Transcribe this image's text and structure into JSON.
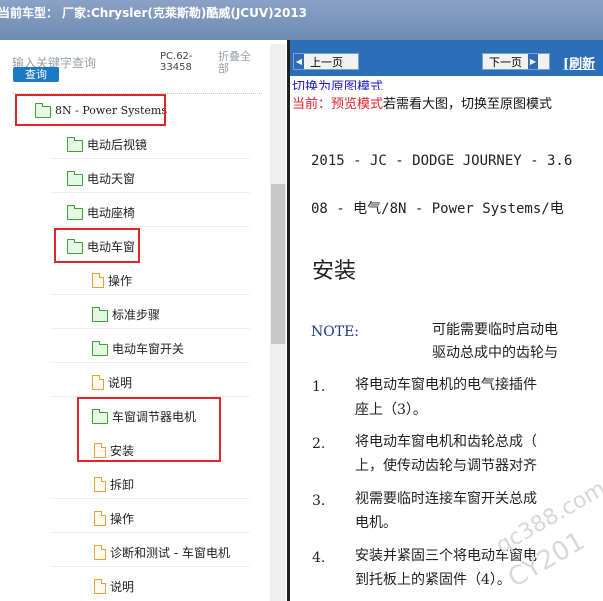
{
  "title_bar": {
    "text": "当前车型： 厂家:Chrysler(克莱斯勒)酷威(JCUV)2013"
  },
  "search": {
    "placeholder": "输入关键字查询",
    "button_label": "查询"
  },
  "pc_code": "PC.62-33458",
  "collapse_all_label": "折叠全部",
  "tree": [
    {
      "label": "8N - Power Systems",
      "icon": "folder-open-icon"
    },
    {
      "label": "电动后视镜",
      "icon": "folder-icon"
    },
    {
      "label": "电动天窗",
      "icon": "folder-icon"
    },
    {
      "label": "电动座椅",
      "icon": "folder-icon"
    },
    {
      "label": "电动车窗",
      "icon": "folder-open-icon"
    },
    {
      "label": "操作",
      "icon": "document-icon"
    },
    {
      "label": "标准步骤",
      "icon": "folder-icon"
    },
    {
      "label": "电动车窗开关",
      "icon": "folder-icon"
    },
    {
      "label": "说明",
      "icon": "document-icon"
    },
    {
      "label": "车窗调节器电机",
      "icon": "folder-open-icon"
    },
    {
      "label": "安装",
      "icon": "document-icon"
    },
    {
      "label": "拆卸",
      "icon": "document-icon"
    },
    {
      "label": "操作",
      "icon": "document-icon"
    },
    {
      "label": "诊断和测试 - 车窗电机",
      "icon": "document-icon"
    },
    {
      "label": "说明",
      "icon": "document-icon"
    }
  ],
  "toolbar": {
    "prev_label": "上一页",
    "next_label": "下一页",
    "refresh_label": "[刷新"
  },
  "links": {
    "switch_original": "切换为原图模式"
  },
  "mode": {
    "current": "当前：预览模式",
    "hint": "若需看大图，切换至原图模式"
  },
  "document": {
    "line1": "2015 - JC - DODGE JOURNEY - 3.6",
    "line2": "08 - 电气/8N - Power Systems/电",
    "heading": "安装",
    "note_label": "NOTE:",
    "note_line1": "可能需要临时启动电",
    "note_line2": "驱动总成中的齿轮与",
    "steps": [
      {
        "num": "1.",
        "line1": "将电动车窗电机的电气接插件",
        "line2": "座上（3）。"
      },
      {
        "num": "2.",
        "line1": "将电动车窗电机和齿轮总成（",
        "line2": "上，使传动齿轮与调节器对齐"
      },
      {
        "num": "3.",
        "line1": "视需要临时连接车窗开关总成",
        "line2": "电机。"
      },
      {
        "num": "4.",
        "line1": "安装并紧固三个将电动车窗电",
        "line2": "到托板上的紧固件（4）。"
      }
    ]
  },
  "watermark": {
    "line1": "qc388.com",
    "line2": "CY201"
  },
  "colors": {
    "title_bar": "#7a93bb",
    "nav_bar": "#2a6fb7",
    "highlight_box": "#e0242c",
    "folder": "#3aa535",
    "document": "#e6a23c",
    "link": "#1a1ad6"
  }
}
